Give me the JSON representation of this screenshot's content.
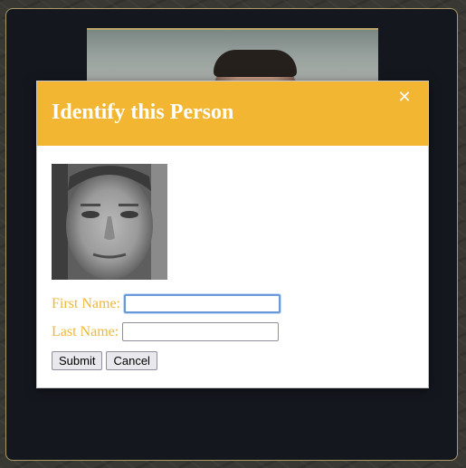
{
  "modal": {
    "title": "Identify this Person",
    "close_glyph": "✕",
    "close_icon": "close-icon"
  },
  "form": {
    "first_name_label": "First Name:",
    "first_name_value": "",
    "first_name_placeholder": "",
    "last_name_label": "Last Name:",
    "last_name_value": "",
    "last_name_placeholder": "",
    "submit_label": "Submit",
    "cancel_label": "Cancel"
  },
  "colors": {
    "accent": "#f2b632",
    "frame_bg": "#15171f",
    "frame_border": "#a89a66"
  }
}
